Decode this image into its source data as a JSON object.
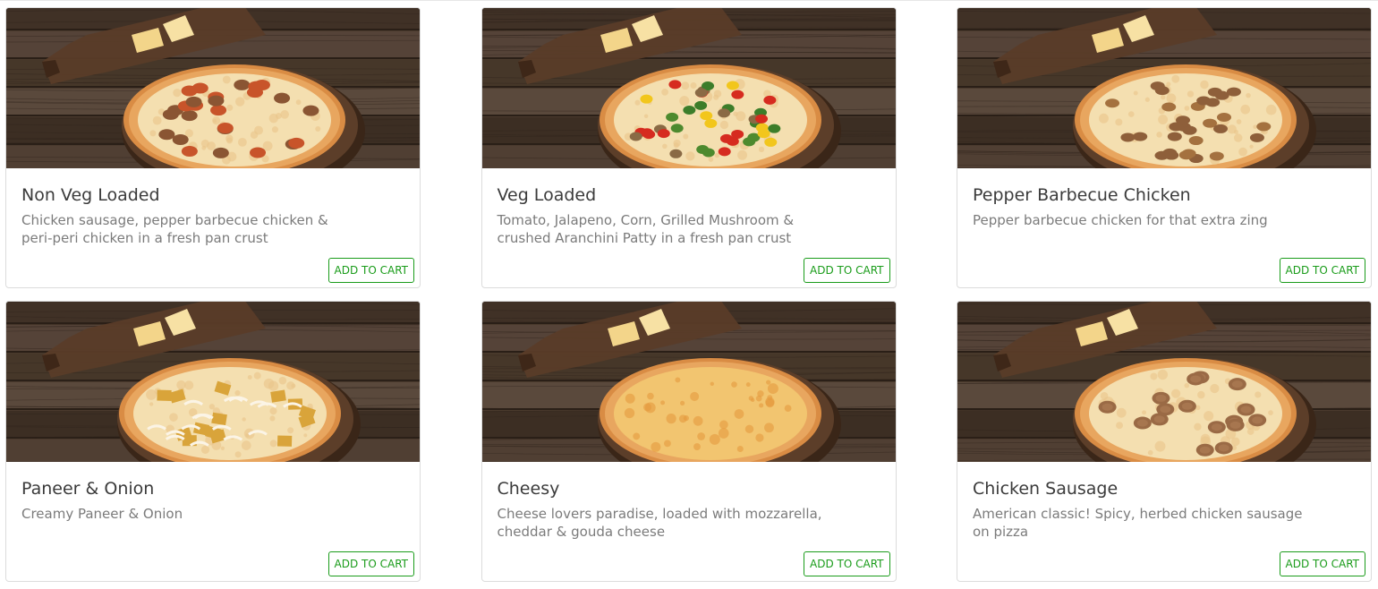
{
  "products": [
    {
      "name": "Non Veg Loaded",
      "description": "Chicken sausage, pepper barbecue chicken & peri-peri chicken in a fresh pan crust",
      "button_label": "ADD TO CART",
      "topping": "meat",
      "image_icon": "pizza-photo"
    },
    {
      "name": "Veg Loaded",
      "description": "Tomato, Jalapeno, Corn, Grilled Mushroom & crushed Aranchini Patty in a fresh pan crust",
      "button_label": "ADD TO CART",
      "topping": "veg",
      "image_icon": "pizza-photo"
    },
    {
      "name": "Pepper Barbecue Chicken",
      "description": "Pepper barbecue chicken for that extra zing",
      "button_label": "ADD TO CART",
      "topping": "chicken",
      "image_icon": "pizza-photo"
    },
    {
      "name": "Paneer & Onion",
      "description": "Creamy Paneer & Onion",
      "button_label": "ADD TO CART",
      "topping": "paneer",
      "image_icon": "pizza-photo"
    },
    {
      "name": "Cheesy",
      "description": "Cheese lovers paradise, loaded with mozzarella, cheddar & gouda cheese",
      "button_label": "ADD TO CART",
      "topping": "cheese",
      "image_icon": "pizza-photo"
    },
    {
      "name": "Chicken Sausage",
      "description": "American classic! Spicy, herbed chicken sausage on pizza",
      "button_label": "ADD TO CART",
      "topping": "sausage",
      "image_icon": "pizza-photo"
    }
  ],
  "colors": {
    "accent_green": "#1a9c1a",
    "title_text": "#3b3b3b",
    "desc_text": "#7b7b7b",
    "wood_dark": "#3f2f22",
    "crust": "#e7a45a"
  }
}
